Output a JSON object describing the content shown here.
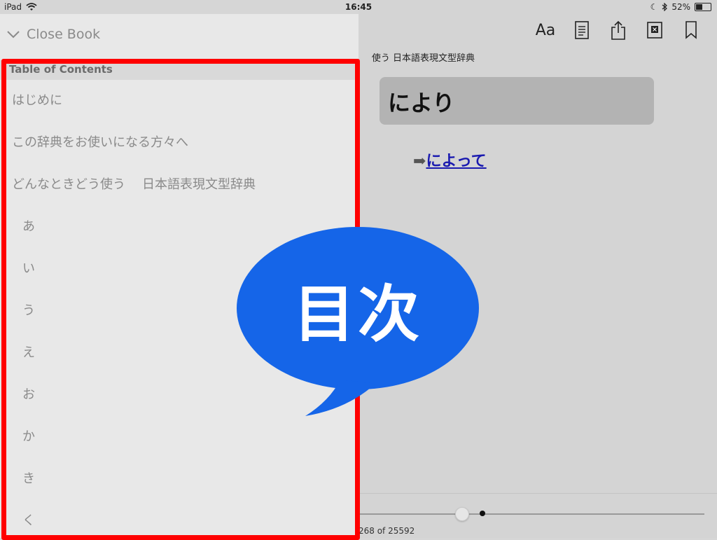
{
  "status_bar": {
    "device": "iPad",
    "time": "16:45",
    "battery_text": "52%",
    "battery_level": 0.52
  },
  "toc": {
    "close_label": "Close Book",
    "header": "Table of Contents",
    "items": [
      {
        "label": "はじめに",
        "level": 1
      },
      {
        "label": "この辞典をお使いになる方々へ",
        "level": 1
      },
      {
        "label": "どんなときどう使う",
        "label_suffix": "日本語表現文型辞典",
        "level": 1
      },
      {
        "label": "あ",
        "level": 2
      },
      {
        "label": "い",
        "level": 2
      },
      {
        "label": "う",
        "level": 2
      },
      {
        "label": "え",
        "level": 2
      },
      {
        "label": "お",
        "level": 2
      },
      {
        "label": "か",
        "level": 2
      },
      {
        "label": "き",
        "level": 2
      },
      {
        "label": "く",
        "level": 2
      }
    ]
  },
  "reader": {
    "book_title": "使う 日本語表現文型辞典",
    "entry_heading": "により",
    "crossref_arrow": "➡",
    "crossref_link": "によって",
    "page_counter": "268 of 25592",
    "progress": 0.0105
  },
  "toolbar": {
    "font_label": "Aa",
    "icons": [
      "font-size-icon",
      "contents-icon",
      "share-icon",
      "dictionary-icon",
      "bookmark-icon"
    ]
  },
  "annotation": {
    "bubble_text": "目次",
    "bubble_color": "#1565e8",
    "frame_color": "#ff0000"
  }
}
